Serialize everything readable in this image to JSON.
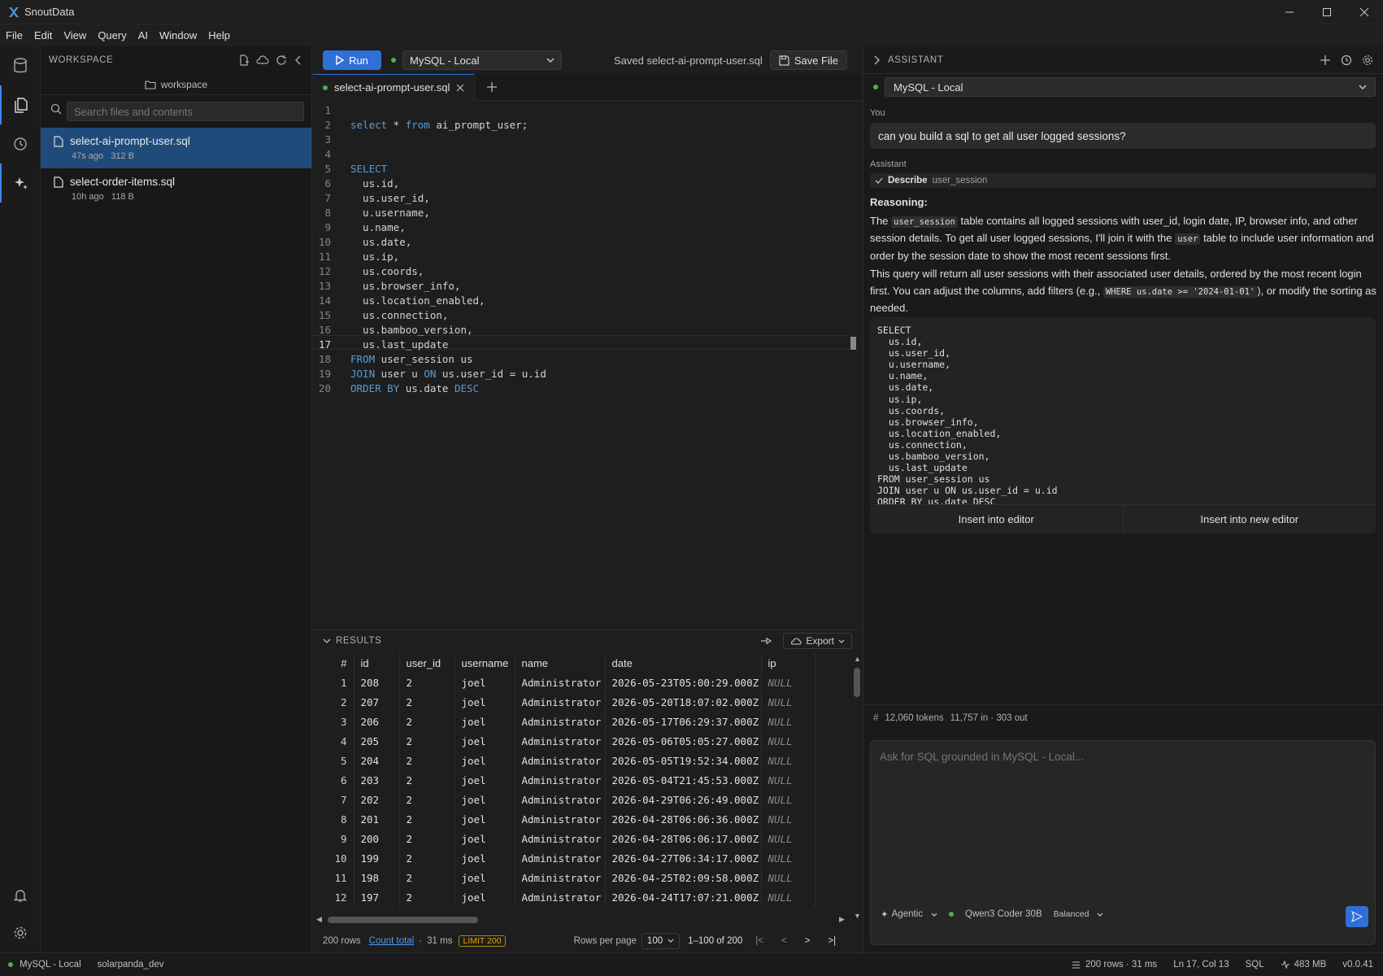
{
  "app": {
    "title": "SnoutData"
  },
  "menu": [
    "File",
    "Edit",
    "View",
    "Query",
    "AI",
    "Window",
    "Help"
  ],
  "sidebar": {
    "title": "WORKSPACE",
    "folder": "workspace",
    "search_placeholder": "Search files and contents",
    "files": [
      {
        "name": "select-ai-prompt-user.sql",
        "meta": "47s ago   312 B",
        "selected": true
      },
      {
        "name": "select-order-items.sql",
        "meta": "10h ago   118 B",
        "selected": false
      }
    ]
  },
  "toolbar": {
    "run_label": "Run",
    "connection": "MySQL - Local",
    "saved_text": "Saved select-ai-prompt-user.sql",
    "save_label": "Save File"
  },
  "tabs": [
    {
      "label": "select-ai-prompt-user.sql"
    }
  ],
  "editor": {
    "current_line": 17,
    "lines": [
      "",
      "select * from ai_prompt_user;",
      "",
      "",
      "SELECT",
      "  us.id,",
      "  us.user_id,",
      "  u.username,",
      "  u.name,",
      "  us.date,",
      "  us.ip,",
      "  us.coords,",
      "  us.browser_info,",
      "  us.location_enabled,",
      "  us.connection,",
      "  us.bamboo_version,",
      "  us.last_update",
      "FROM user_session us",
      "JOIN user u ON us.user_id = u.id",
      "ORDER BY us.date DESC"
    ]
  },
  "results": {
    "title": "RESULTS",
    "export_label": "Export",
    "columns": [
      "#",
      "id",
      "user_id",
      "username",
      "name",
      "date",
      "ip"
    ],
    "rows": [
      [
        "1",
        "208",
        "2",
        "joel",
        "Administrator",
        "2026-05-23T05:00:29.000Z",
        "NULL"
      ],
      [
        "2",
        "207",
        "2",
        "joel",
        "Administrator",
        "2026-05-20T18:07:02.000Z",
        "NULL"
      ],
      [
        "3",
        "206",
        "2",
        "joel",
        "Administrator",
        "2026-05-17T06:29:37.000Z",
        "NULL"
      ],
      [
        "4",
        "205",
        "2",
        "joel",
        "Administrator",
        "2026-05-06T05:05:27.000Z",
        "NULL"
      ],
      [
        "5",
        "204",
        "2",
        "joel",
        "Administrator",
        "2026-05-05T19:52:34.000Z",
        "NULL"
      ],
      [
        "6",
        "203",
        "2",
        "joel",
        "Administrator",
        "2026-05-04T21:45:53.000Z",
        "NULL"
      ],
      [
        "7",
        "202",
        "2",
        "joel",
        "Administrator",
        "2026-04-29T06:26:49.000Z",
        "NULL"
      ],
      [
        "8",
        "201",
        "2",
        "joel",
        "Administrator",
        "2026-04-28T06:06:36.000Z",
        "NULL"
      ],
      [
        "9",
        "200",
        "2",
        "joel",
        "Administrator",
        "2026-04-28T06:06:17.000Z",
        "NULL"
      ],
      [
        "10",
        "199",
        "2",
        "joel",
        "Administrator",
        "2026-04-27T06:34:17.000Z",
        "NULL"
      ],
      [
        "11",
        "198",
        "2",
        "joel",
        "Administrator",
        "2026-04-25T02:09:58.000Z",
        "NULL"
      ],
      [
        "12",
        "197",
        "2",
        "joel",
        "Administrator",
        "2026-04-24T17:07:21.000Z",
        "NULL"
      ]
    ],
    "footer": {
      "row_count": "200 rows",
      "count_total": "Count total",
      "time": "31 ms",
      "limit": "LIMIT 200",
      "rows_per_page_label": "Rows per page",
      "rows_per_page": "100",
      "range": "1–100 of 200"
    }
  },
  "assistant": {
    "title": "ASSISTANT",
    "connection": "MySQL - Local",
    "you_label": "You",
    "user_message": "can you build a sql to get all user logged sessions?",
    "assistant_label": "Assistant",
    "tool": {
      "name": "Describe",
      "arg": "user_session"
    },
    "reasoning_label": "Reasoning:",
    "reasoning": {
      "p1_a": "The ",
      "p1_code1": "user_session",
      "p1_b": " table contains all logged sessions with user_id, login date, IP, browser info, and other session details. To get all user logged sessions, I'll join it with the ",
      "p1_code2": "user",
      "p1_c": " table to include user information and order by the session date to show the most recent sessions first.",
      "p2_a": "This query will return all user sessions with their associated user details, ordered by the most recent login first. You can adjust the columns, add filters (e.g., ",
      "p2_code": "WHERE us.date >= '2024-01-01'",
      "p2_b": "), or modify the sorting as needed."
    },
    "code": "SELECT\n  us.id,\n  us.user_id,\n  u.username,\n  u.name,\n  us.date,\n  us.ip,\n  us.coords,\n  us.browser_info,\n  us.location_enabled,\n  us.connection,\n  us.bamboo_version,\n  us.last_update\nFROM user_session us\nJOIN user u ON us.user_id = u.id\nORDER BY us.date DESC",
    "insert_label": "Insert into editor",
    "insert_new_label": "Insert into new editor",
    "tokens_total": "12,060 tokens",
    "tokens_detail": "11,757 in · 303 out",
    "prompt_placeholder": "Ask for SQL grounded in MySQL - Local...",
    "mode": "Agentic",
    "model": "Qwen3 Coder 30B",
    "effort": "Balanced"
  },
  "statusbar": {
    "connection": "MySQL - Local",
    "database": "solarpanda_dev",
    "rows_time": "200 rows · 31 ms",
    "cursor": "Ln 17, Col 13",
    "language": "SQL",
    "memory": "483 MB",
    "version": "v0.0.41"
  },
  "colors": {
    "accent": "#2f6fd6",
    "selection": "#1f4b7a",
    "keyword": "#569cd6",
    "connected": "#4caf50"
  }
}
